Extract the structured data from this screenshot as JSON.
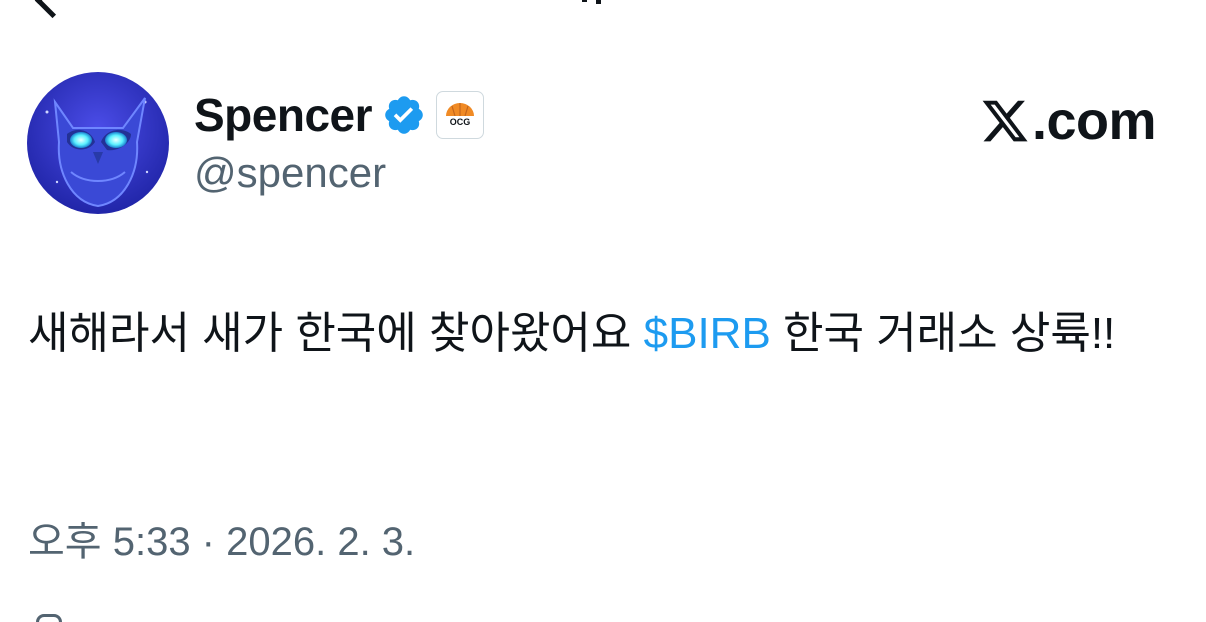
{
  "author": {
    "display_name": "Spencer",
    "handle": "@spencer",
    "verified": true,
    "affiliation_badge_text": "OCG",
    "avatar_icon": "owl-avatar-icon"
  },
  "brand": {
    "x_glyph_icon": "x-logo-icon",
    "suffix": ".com"
  },
  "tweet": {
    "text_before": "새해라서 새가 한국에 찾아왔어요 ",
    "cashtag": "$BIRB",
    "text_after": " 한국 거래소 상륙!!"
  },
  "meta": {
    "timestamp": "오후 5:33 · 2026. 2. 3."
  },
  "colors": {
    "text_primary": "#0f1419",
    "text_secondary": "#536471",
    "link": "#1d9bf0",
    "verified_badge": "#1d9bf0",
    "affiliation_orange": "#f08a24"
  }
}
